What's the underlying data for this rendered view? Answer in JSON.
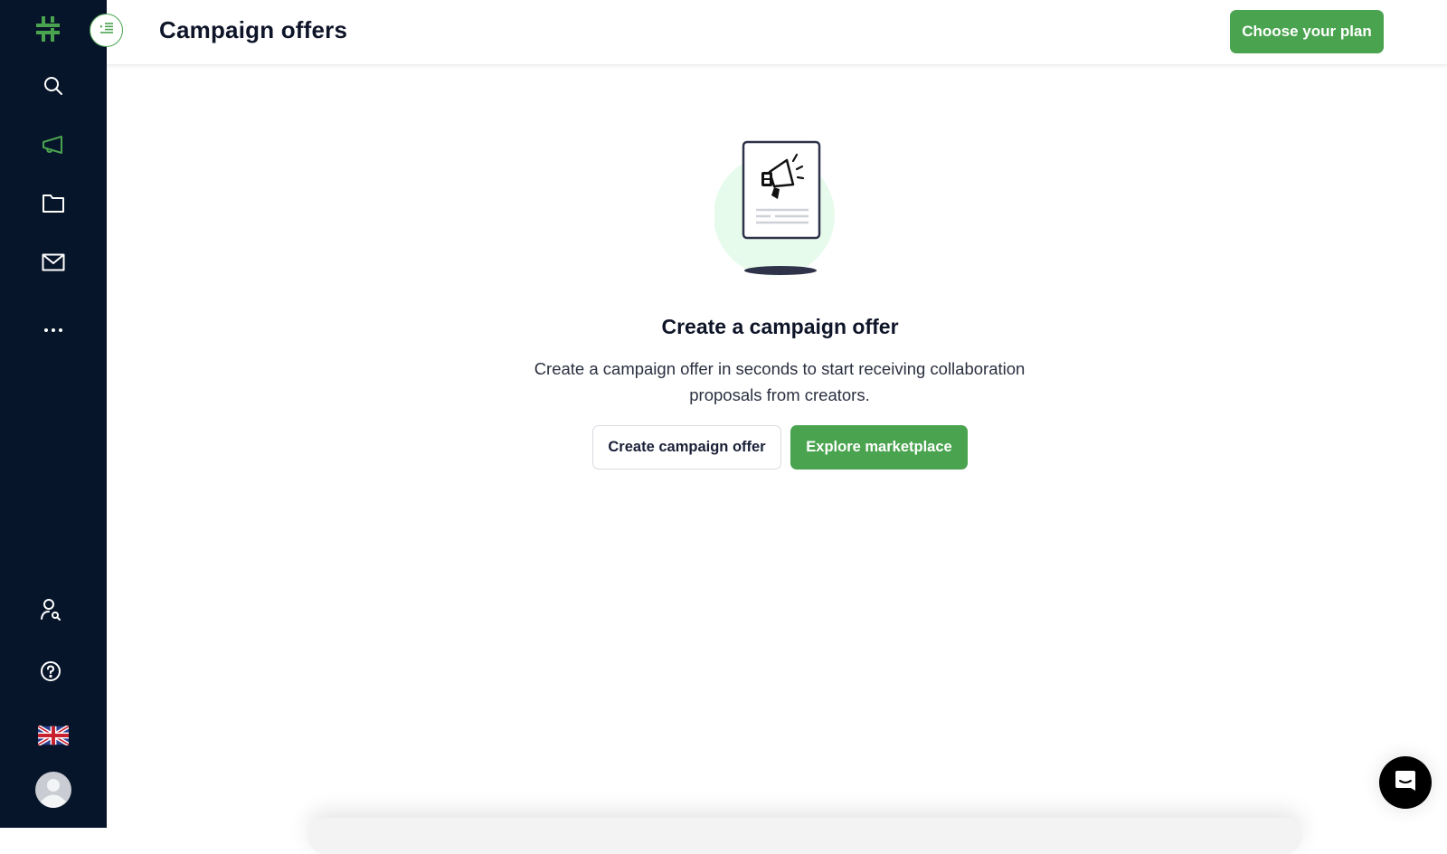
{
  "header": {
    "title": "Campaign offers",
    "plan_button": "Choose your plan"
  },
  "sidebar": {
    "logo": "hashtag-logo",
    "items": [
      {
        "name": "search",
        "icon": "search-icon",
        "active": false
      },
      {
        "name": "campaigns",
        "icon": "megaphone-icon",
        "active": true
      },
      {
        "name": "folders",
        "icon": "folder-icon",
        "active": false
      },
      {
        "name": "messages",
        "icon": "mail-icon",
        "active": false
      },
      {
        "name": "more",
        "icon": "more-icon",
        "active": false
      }
    ],
    "bottom_items": [
      {
        "name": "find-creators",
        "icon": "user-search-icon"
      },
      {
        "name": "help",
        "icon": "help-icon"
      },
      {
        "name": "language",
        "icon": "uk-flag-icon"
      },
      {
        "name": "profile",
        "icon": "avatar"
      }
    ]
  },
  "empty_state": {
    "title": "Create a campaign offer",
    "description": "Create a campaign offer in seconds to start receiving collaboration proposals from creators.",
    "primary_button": "Create campaign offer",
    "secondary_button": "Explore marketplace"
  },
  "colors": {
    "brand_green": "#4aa34f",
    "sidebar_bg": "#07152a",
    "illustration_circle": "#e6fbec"
  }
}
